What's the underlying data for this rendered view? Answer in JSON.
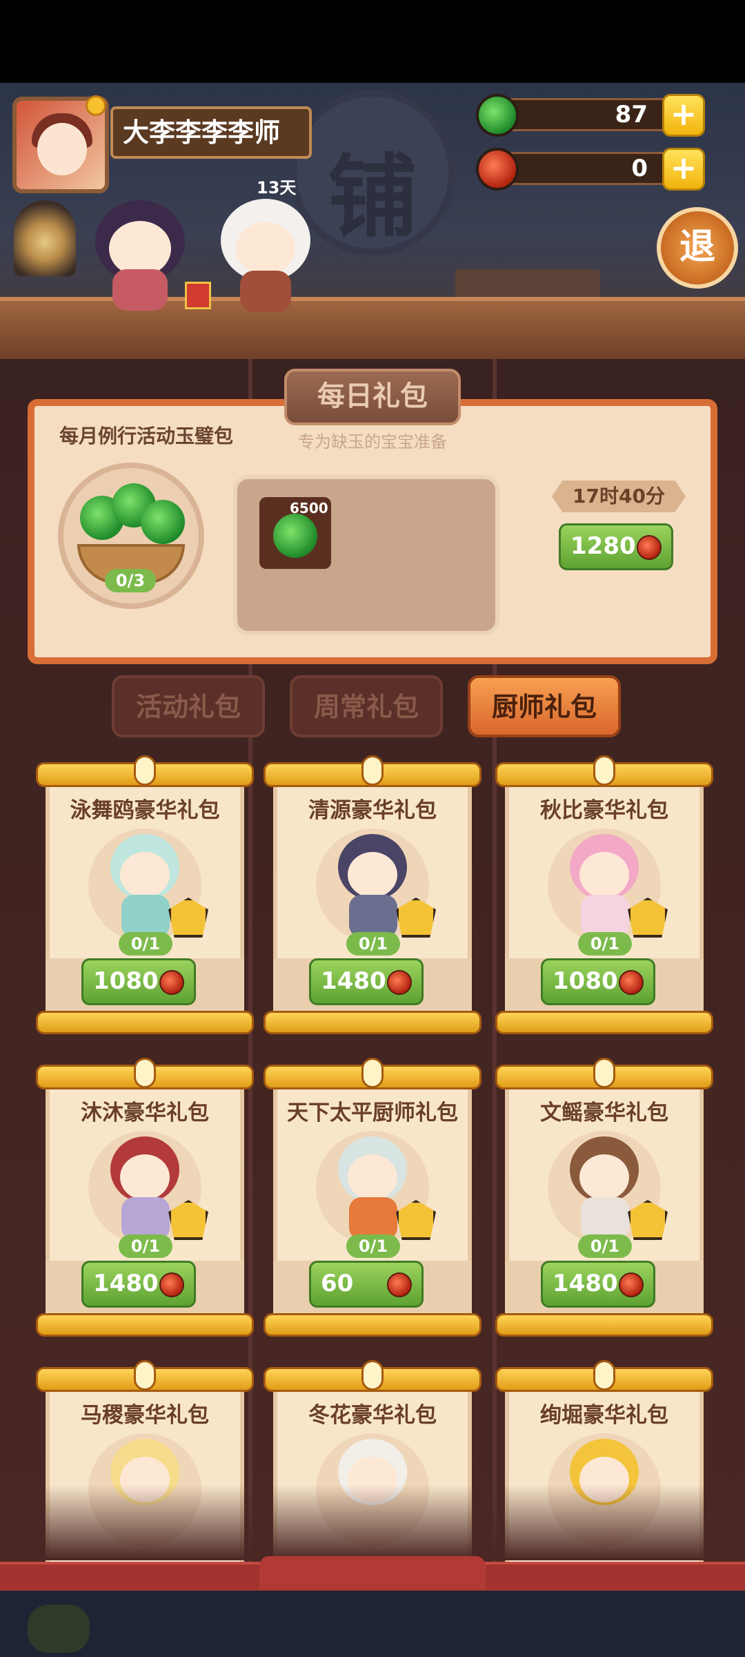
{
  "player": {
    "name": "大李李李李师"
  },
  "companion": {
    "days_label": "13天"
  },
  "currency": {
    "jade": {
      "value": "87",
      "icon": "green-jade-icon"
    },
    "ruby": {
      "value": "0",
      "icon": "red-jade-icon"
    }
  },
  "exit_label": "退",
  "shop_sign": "铺",
  "daily": {
    "tab_title": "每日礼包",
    "subtitle": "专为缺玉的宝宝准备",
    "pack_name": "每月例行活动玉璧包",
    "progress": "0/3",
    "reward_qty": "6500",
    "timer": "17时40分",
    "price": "1280"
  },
  "tabs": [
    {
      "label": "活动礼包",
      "active": false
    },
    {
      "label": "周常礼包",
      "active": false
    },
    {
      "label": "厨师礼包",
      "active": true
    }
  ],
  "packs": [
    {
      "title": "泳舞鸥豪华礼包",
      "progress": "0/1",
      "price": "1080",
      "hair": "#bfe6df",
      "outfit": "#8fd1c8"
    },
    {
      "title": "清源豪华礼包",
      "progress": "0/1",
      "price": "1480",
      "hair": "#4a4466",
      "outfit": "#6b6f8f"
    },
    {
      "title": "秋比豪华礼包",
      "progress": "0/1",
      "price": "1080",
      "hair": "#f3a9c6",
      "outfit": "#f6d3e0"
    },
    {
      "title": "沐沐豪华礼包",
      "progress": "0/1",
      "price": "1480",
      "hair": "#b23a3a",
      "outfit": "#b7a6d6"
    },
    {
      "title": "天下太平厨师礼包",
      "progress": "0/1",
      "price": "60",
      "hair": "#d8e4e2",
      "outfit": "#e57a3a"
    },
    {
      "title": "文鳐豪华礼包",
      "progress": "0/1",
      "price": "1480",
      "hair": "#8a5a3c",
      "outfit": "#e8e2da"
    },
    {
      "title": "马稷豪华礼包",
      "hair": "#f6dc8c",
      "outfit": "#a6c98a"
    },
    {
      "title": "冬花豪华礼包",
      "hair": "#f2efe9",
      "outfit": "#d9d2e6"
    },
    {
      "title": "绚堀豪华礼包",
      "hair": "#f4c43a",
      "outfit": "#e2b23a"
    }
  ]
}
